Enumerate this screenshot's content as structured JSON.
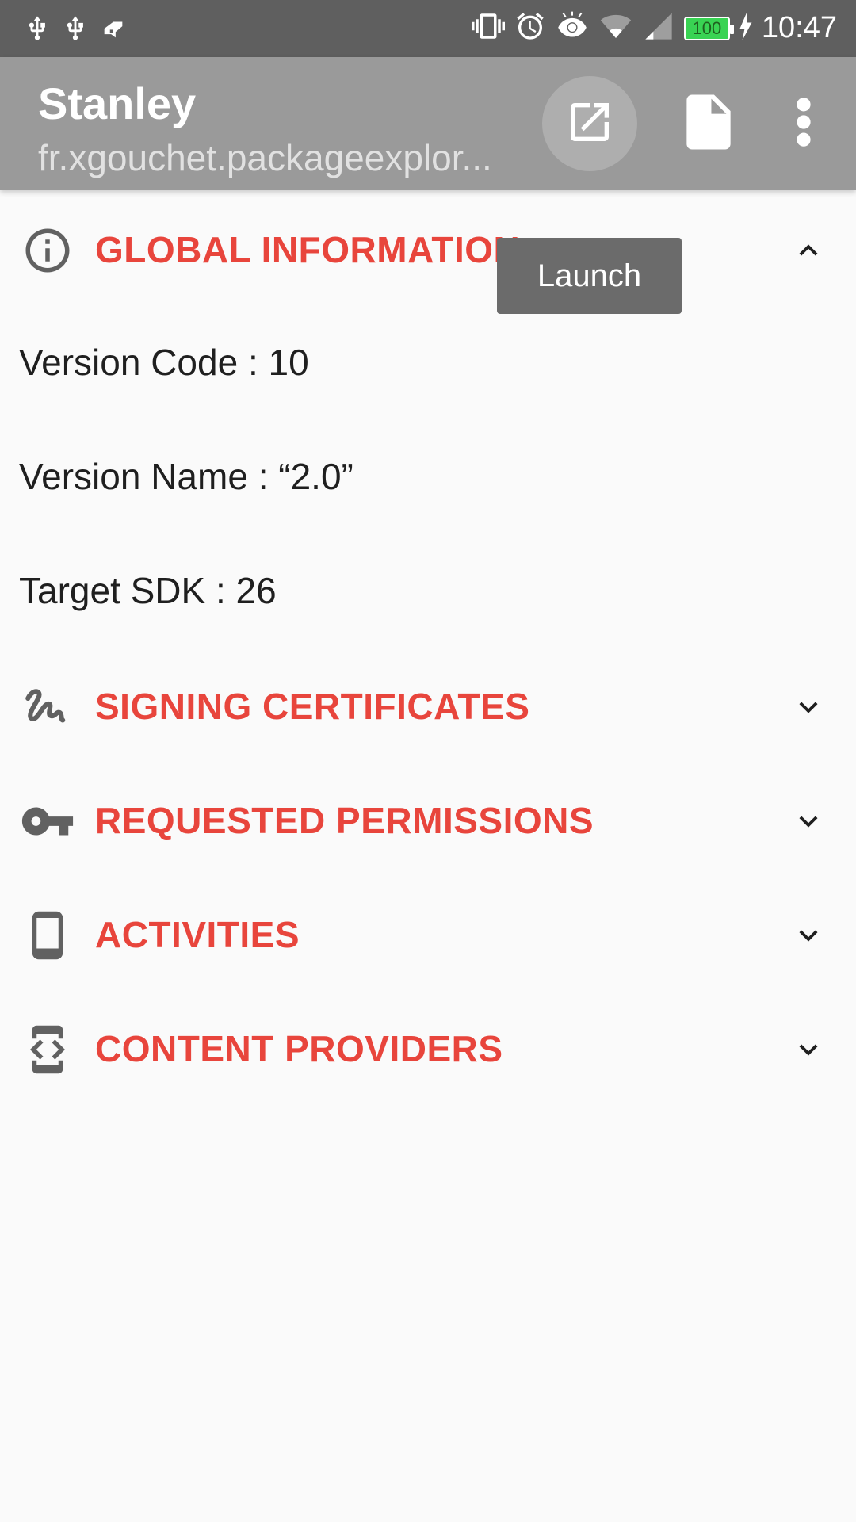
{
  "status_bar": {
    "time": "10:47",
    "battery_level": "100"
  },
  "app_bar": {
    "title": "Stanley",
    "subtitle": "fr.xgouchet.packageexplor..."
  },
  "tooltip": {
    "text": "Launch"
  },
  "sections": [
    {
      "title": "GLOBAL INFORMATION",
      "expanded": true,
      "icon": "info-icon",
      "details": [
        "Version Code : 10",
        "Version Name : “2.0”",
        "Target SDK : 26"
      ]
    },
    {
      "title": "SIGNING CERTIFICATES",
      "expanded": false,
      "icon": "signature-icon"
    },
    {
      "title": "REQUESTED PERMISSIONS",
      "expanded": false,
      "icon": "key-icon"
    },
    {
      "title": "ACTIVITIES",
      "expanded": false,
      "icon": "phone-icon"
    },
    {
      "title": "CONTENT PROVIDERS",
      "expanded": false,
      "icon": "developer-mode-icon"
    }
  ],
  "colors": {
    "accent": "#e8453c",
    "app_bar": "#9a9a9a",
    "status_bar": "#5f5f5f",
    "background": "#fafafa"
  }
}
